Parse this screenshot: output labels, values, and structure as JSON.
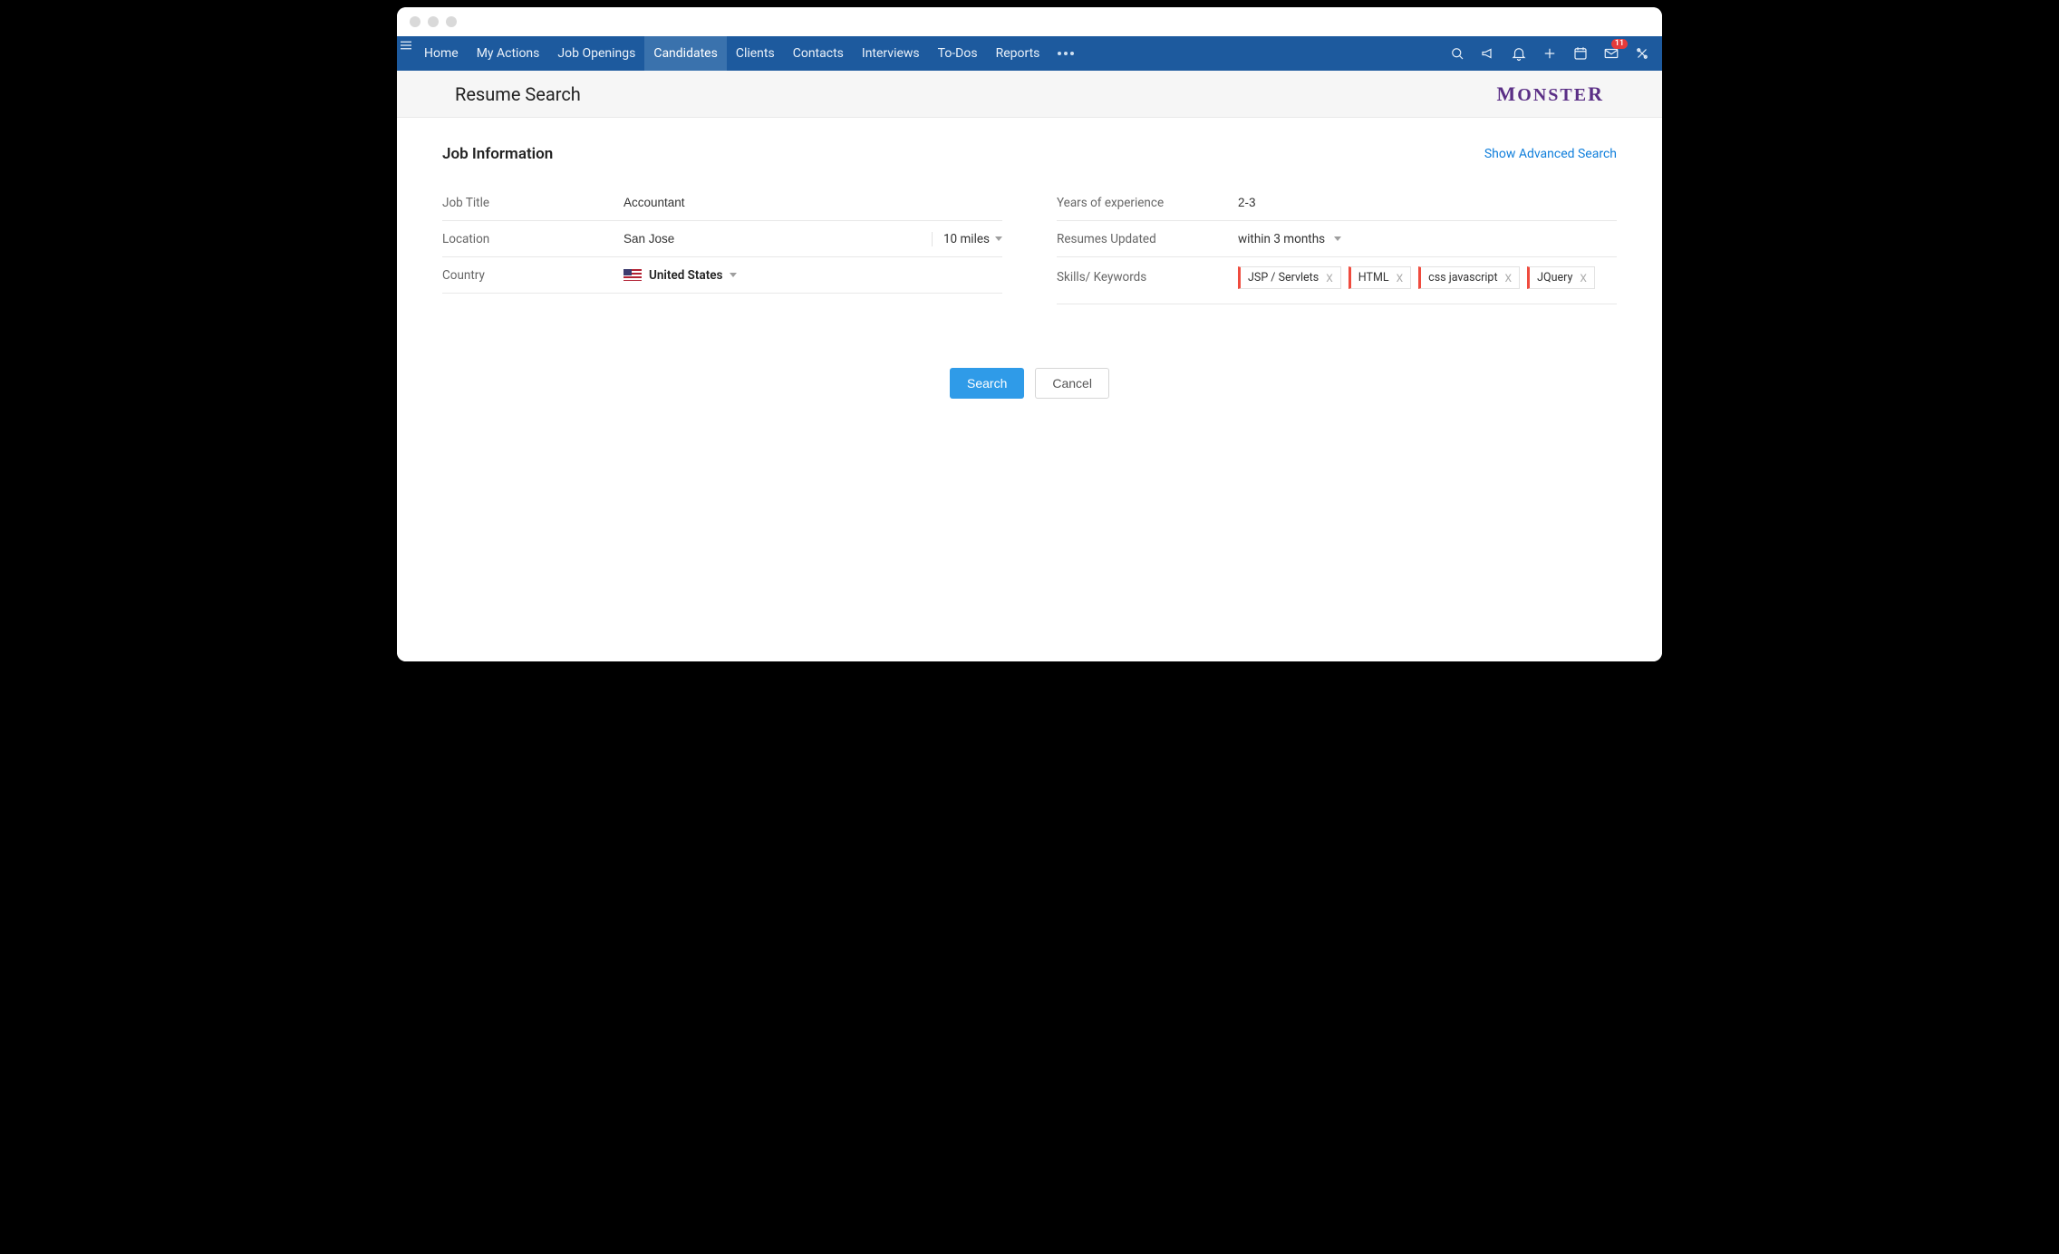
{
  "nav": {
    "items": [
      "Home",
      "My Actions",
      "Job Openings",
      "Candidates",
      "Clients",
      "Contacts",
      "Interviews",
      "To-Dos",
      "Reports"
    ],
    "active_index": 3,
    "mail_badge": "11"
  },
  "subheader": {
    "title": "Resume Search",
    "brand": "MONSTER"
  },
  "section": {
    "title": "Job Information",
    "advanced_link": "Show Advanced Search"
  },
  "form": {
    "labels": {
      "job_title": "Job Title",
      "location": "Location",
      "country": "Country",
      "years": "Years of experience",
      "resumes_updated": "Resumes Updated",
      "skills": "Skills/ Keywords"
    },
    "values": {
      "job_title": "Accountant",
      "location": "San Jose",
      "distance": "10 miles",
      "country": "United States",
      "years": "2-3",
      "resumes_updated": "within 3 months"
    },
    "skills": [
      "JSP / Servlets",
      "HTML",
      "css javascript",
      "JQuery"
    ]
  },
  "buttons": {
    "search": "Search",
    "cancel": "Cancel"
  }
}
